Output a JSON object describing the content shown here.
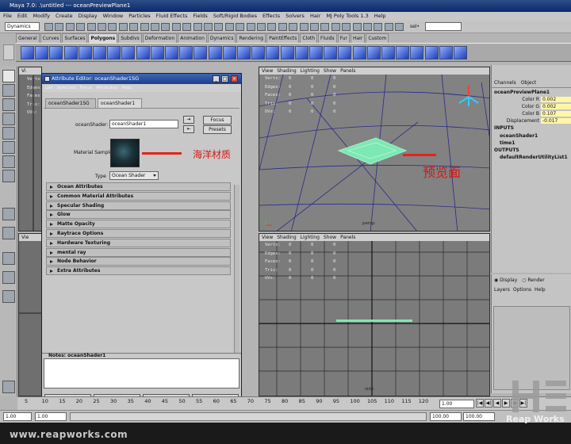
{
  "app": {
    "title": "Maya 7.0: .\\untitled     ---   oceanPreviewPlane1"
  },
  "menubar": {
    "items": [
      "File",
      "Edit",
      "Modify",
      "Create",
      "Display",
      "Window",
      "Particles",
      "Fluid Effects",
      "Fields",
      "Soft/Rigid Bodies",
      "Effects",
      "Solvers",
      "Hair",
      "MJ Poly Tools 1.3",
      "Help"
    ]
  },
  "statusline": {
    "mode": "Dynamics",
    "sel_label": "sel•"
  },
  "shelf": {
    "tabs": [
      "General",
      "Curves",
      "Surfaces",
      "Polygons",
      "Subdivs",
      "Deformation",
      "Animation",
      "Dynamics",
      "Rendering",
      "PaintEffects",
      "Cloth",
      "Fluids",
      "Fur",
      "Hair",
      "Custom"
    ],
    "active_tab": "Polygons"
  },
  "viewports": {
    "menu": [
      "View",
      "Shading",
      "Lighting",
      "Show",
      "Panels"
    ],
    "hud_labels": [
      "Verts:",
      "Edges:",
      "Faces:",
      "Tris:",
      "UVs:"
    ],
    "hud_values": [
      "0",
      "0",
      "0"
    ],
    "persp_label": "persp",
    "side_label": "side"
  },
  "attribute_editor": {
    "title": "Attribute Editor: oceanShader1SG",
    "menu": [
      "List",
      "Selected",
      "Focus",
      "Attributes",
      "Help"
    ],
    "tabs": [
      "oceanShader1SG",
      "oceanShader1"
    ],
    "active_tab": "oceanShader1",
    "shader_label": "oceanShader:",
    "shader_value": "oceanShader1",
    "focus_button": "Focus",
    "presets_button": "Presets",
    "material_sample_label": "Material Sample",
    "type_label": "Type",
    "type_value": "Ocean Shader",
    "sections": [
      "Ocean Attributes",
      "Common Material Attributes",
      "Specular Shading",
      "Glow",
      "Matte Opacity",
      "Raytrace Options",
      "Hardware Texturing",
      "mental ray",
      "Node Behavior",
      "Extra Attributes"
    ],
    "notes_label": "Notes: oceanShader1",
    "buttons": [
      "Select",
      "Load Attributes",
      "Copy Tab",
      "Close"
    ]
  },
  "annotations": {
    "material": "海洋材质",
    "preview": "预览面"
  },
  "channel_box": {
    "tabs": [
      "Channels",
      "Object"
    ],
    "object_name": "oceanPreviewPlane1",
    "attributes": [
      {
        "name": "Color R",
        "value": "0.002"
      },
      {
        "name": "Color G",
        "value": "0.002"
      },
      {
        "name": "Color B",
        "value": "0.107"
      },
      {
        "name": "Displacement",
        "value": "-0.017"
      }
    ],
    "inputs_label": "INPUTS",
    "inputs": [
      "oceanShader1",
      "time1"
    ],
    "outputs_label": "OUTPUTS",
    "outputs": [
      "defaultRenderUtilityList1"
    ]
  },
  "layer_editor": {
    "display_label": "Display",
    "render_label": "Render",
    "menu": [
      "Layers",
      "Options",
      "Help"
    ]
  },
  "timeline": {
    "ticks": [
      "5",
      "10",
      "15",
      "20",
      "25",
      "30",
      "35",
      "40",
      "45",
      "50",
      "55",
      "60",
      "65",
      "70",
      "75",
      "80",
      "85",
      "90",
      "95",
      "100",
      "105",
      "110",
      "115",
      "120"
    ],
    "current_frame": "1.00",
    "range_start": "1.00",
    "range_start2": "1.00",
    "range_end": "100.00",
    "range_end2": "100.00"
  },
  "watermarks": {
    "url": "www.reapworks.com",
    "brand": "Reap Works"
  },
  "colors": {
    "title_blue": "#1a3f8e",
    "preview_plane": "#7de8b4",
    "annotation_red": "#d21a10",
    "highlight_yellow": "#fff7a8"
  }
}
